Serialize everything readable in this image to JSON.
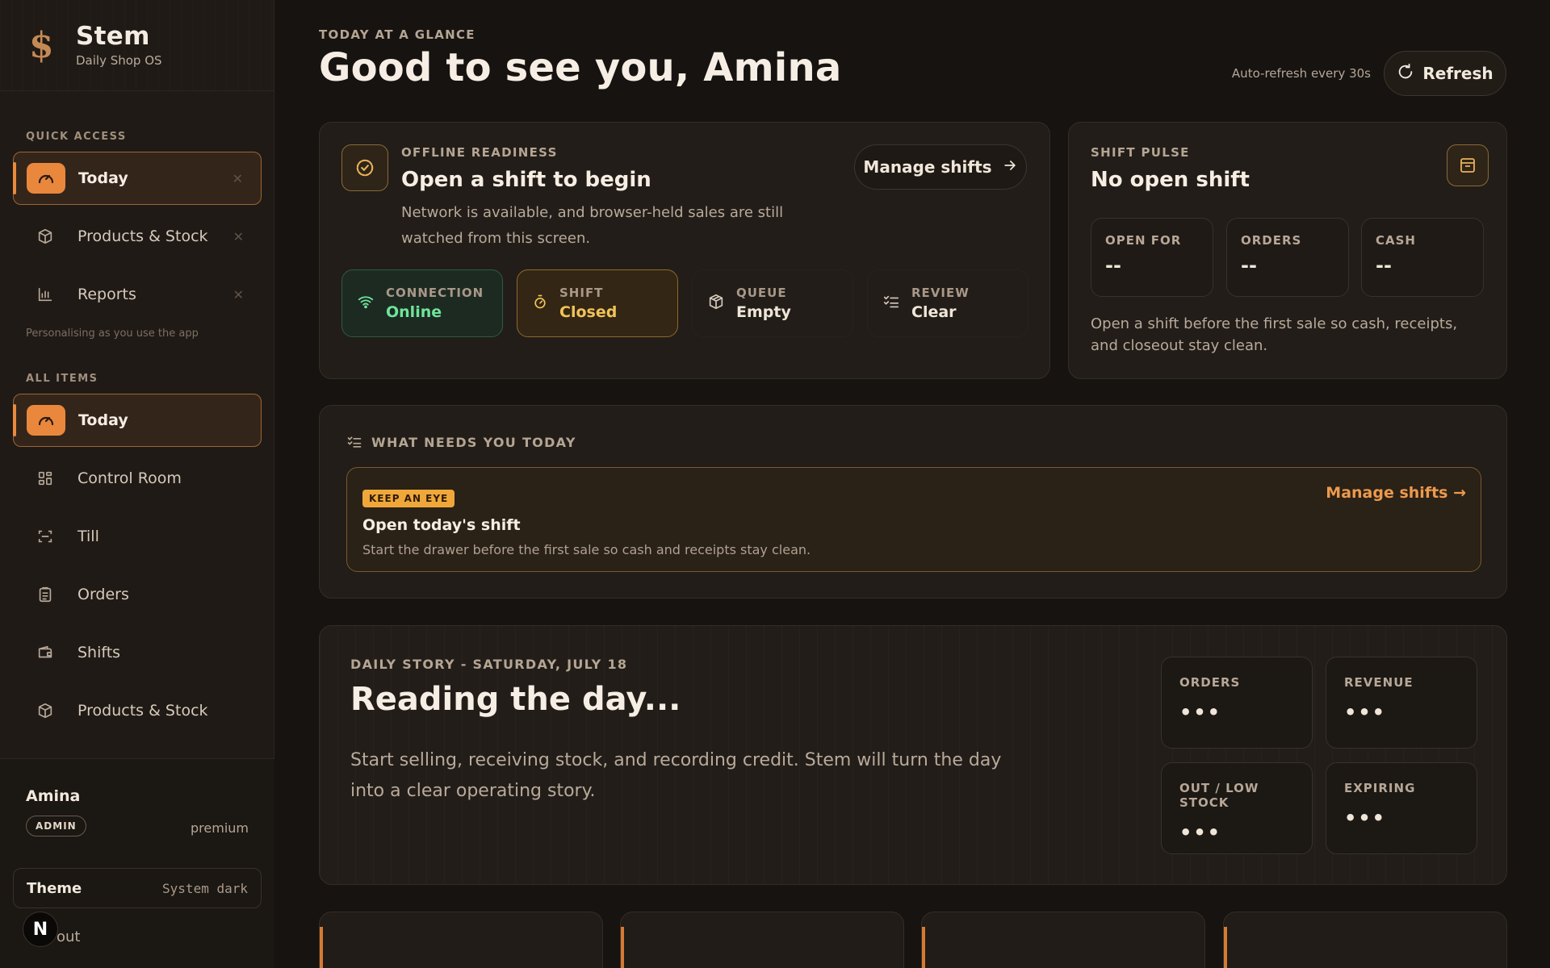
{
  "brand": {
    "name": "Stem",
    "subtitle": "Daily Shop OS",
    "logo_glyph": "$"
  },
  "sidebar": {
    "quick_access_label": "QUICK ACCESS",
    "quick_access": [
      {
        "label": "Today",
        "icon": "gauge-icon",
        "active": true
      },
      {
        "label": "Products & Stock",
        "icon": "box-icon",
        "active": false
      },
      {
        "label": "Reports",
        "icon": "bar-chart-icon",
        "active": false
      }
    ],
    "hint": "Personalising as you use the app",
    "all_items_label": "ALL ITEMS",
    "all_items": [
      {
        "label": "Today",
        "icon": "gauge-icon",
        "active": true
      },
      {
        "label": "Control Room",
        "icon": "grid-icon",
        "active": false
      },
      {
        "label": "Till",
        "icon": "scan-icon",
        "active": false
      },
      {
        "label": "Orders",
        "icon": "clipboard-icon",
        "active": false
      },
      {
        "label": "Shifts",
        "icon": "wallet-icon",
        "active": false
      },
      {
        "label": "Products & Stock",
        "icon": "box-icon",
        "active": false
      }
    ]
  },
  "user": {
    "name": "Amina",
    "role": "ADMIN",
    "plan": "premium",
    "logout_label": "out"
  },
  "theme": {
    "label": "Theme",
    "value": "System dark"
  },
  "floating_badge": "N",
  "header": {
    "eyebrow": "TODAY AT A GLANCE",
    "title": "Good to see you, Amina",
    "auto_refresh": "Auto-refresh every 30s",
    "refresh_label": "Refresh"
  },
  "readiness": {
    "eyebrow": "OFFLINE READINESS",
    "title": "Open a shift to begin",
    "body": "Network is available, and browser-held sales are still watched from this screen.",
    "button": "Manage shifts",
    "tiles": [
      {
        "label": "CONNECTION",
        "value": "Online",
        "icon": "wifi-icon"
      },
      {
        "label": "SHIFT",
        "value": "Closed",
        "icon": "timer-icon"
      },
      {
        "label": "QUEUE",
        "value": "Empty",
        "icon": "cube-icon"
      },
      {
        "label": "REVIEW",
        "value": "Clear",
        "icon": "checklist-icon"
      }
    ]
  },
  "pulse": {
    "eyebrow": "SHIFT PULSE",
    "title": "No open shift",
    "metrics": [
      {
        "label": "OPEN FOR",
        "value": "--"
      },
      {
        "label": "ORDERS",
        "value": "--"
      },
      {
        "label": "CASH",
        "value": "--"
      }
    ],
    "body": "Open a shift before the first sale so cash, receipts, and closeout stay clean."
  },
  "needs": {
    "title": "WHAT NEEDS YOU TODAY",
    "task": {
      "tag": "KEEP AN EYE",
      "title": "Open today's shift",
      "description": "Start the drawer before the first sale so cash and receipts stay clean.",
      "link": "Manage shifts →"
    }
  },
  "story": {
    "eyebrow": "DAILY STORY - SATURDAY, JULY 18",
    "title": "Reading the day...",
    "body": "Start selling, receiving stock, and recording credit. Stem will turn the day into a clear operating story.",
    "metrics": [
      {
        "label": "ORDERS",
        "value": "•••"
      },
      {
        "label": "REVENUE",
        "value": "•••"
      },
      {
        "label": "OUT / LOW STOCK",
        "value": "•••"
      },
      {
        "label": "EXPIRING",
        "value": "•••"
      }
    ]
  },
  "colors": {
    "accent": "#e9873d",
    "online": "#6ee59a",
    "closed": "#f2c35a",
    "background": "#161310"
  }
}
